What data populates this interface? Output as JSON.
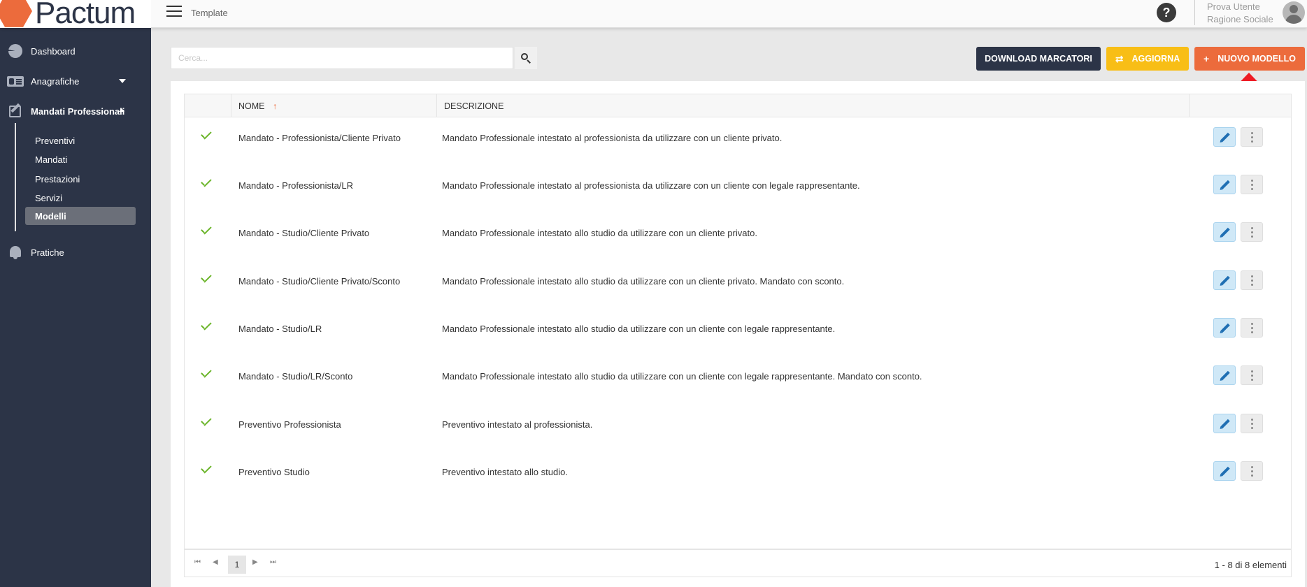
{
  "brand": {
    "name": "Pactum",
    "accent": "#ec6b3c",
    "sidebar_bg": "#2c3447"
  },
  "topbar": {
    "breadcrumb": "Template",
    "help_icon": "?",
    "user_name": "Prova Utente",
    "user_company": "Ragione Sociale"
  },
  "sidebar": {
    "items": [
      {
        "label": "Dashboard",
        "icon": "pie-chart-icon"
      },
      {
        "label": "Anagrafiche",
        "icon": "id-card-icon"
      },
      {
        "label": "Mandati Professionali",
        "icon": "edit-icon"
      },
      {
        "label": "Pratiche",
        "icon": "bell-icon"
      }
    ],
    "subitems": [
      "Preventivi",
      "Mandati",
      "Prestazioni",
      "Servizi",
      "Modelli"
    ]
  },
  "search": {
    "placeholder": "Cerca..."
  },
  "toolbar": {
    "download_label": "Download marcatori",
    "refresh_label": "Aggiorna",
    "new_label": "Nuovo modello"
  },
  "grid": {
    "columns": {
      "name": "Nome",
      "description": "Descrizione"
    },
    "rows": [
      {
        "name": "Mandato - Professionista/Cliente Privato",
        "description": "Mandato Professionale intestato al professionista da utilizzare con un cliente privato."
      },
      {
        "name": "Mandato - Professionista/LR",
        "description": "Mandato Professionale intestato al professionista da utilizzare con un cliente con legale rappresentante."
      },
      {
        "name": "Mandato - Studio/Cliente Privato",
        "description": "Mandato Professionale intestato allo studio da utilizzare con un cliente privato."
      },
      {
        "name": "Mandato - Studio/Cliente Privato/Sconto",
        "description": "Mandato Professionale intestato allo studio da utilizzare con un cliente privato. Mandato con sconto."
      },
      {
        "name": "Mandato - Studio/LR",
        "description": "Mandato Professionale intestato allo studio da utilizzare con un cliente con legale rappresentante."
      },
      {
        "name": "Mandato - Studio/LR/Sconto",
        "description": "Mandato Professionale intestato allo studio da utilizzare con un cliente con legale rappresentante. Mandato con sconto."
      },
      {
        "name": "Preventivo Professionista",
        "description": "Preventivo intestato al professionista."
      },
      {
        "name": "Preventivo Studio",
        "description": "Preventivo intestato allo studio."
      }
    ],
    "pager": {
      "current_page": "1",
      "info": "1 - 8 di 8 elementi"
    }
  }
}
